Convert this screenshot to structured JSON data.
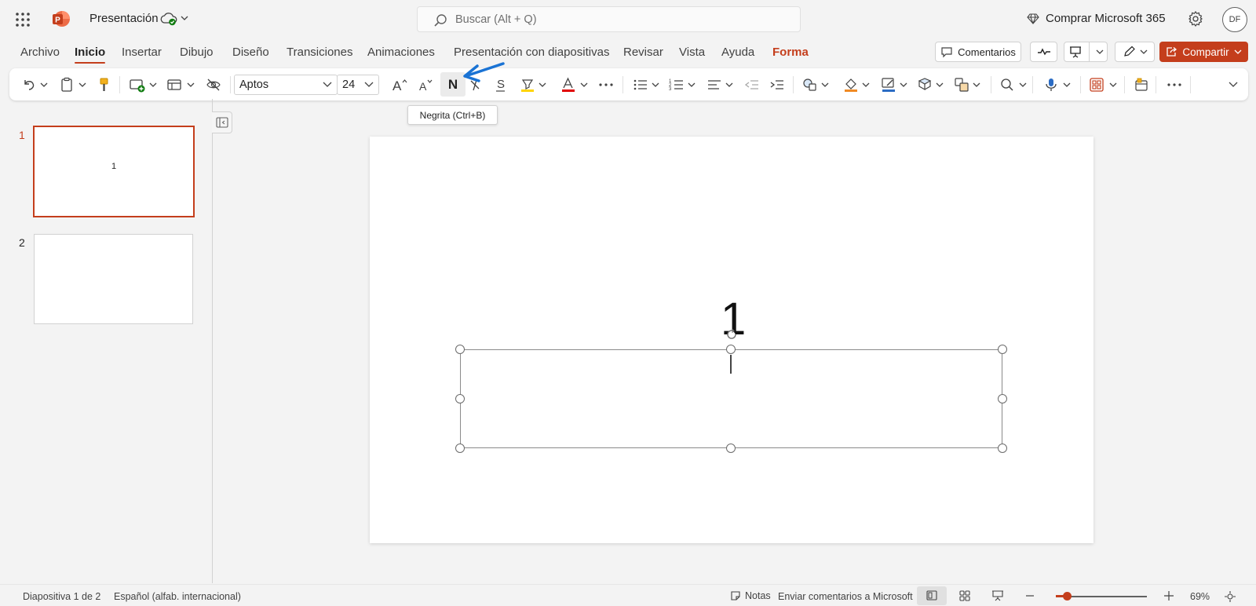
{
  "app": {
    "title": "Presentación",
    "search_placeholder": "Buscar (Alt + Q)",
    "buy_label": "Comprar Microsoft 365",
    "user_initials": "DF"
  },
  "tabs": [
    "Archivo",
    "Inicio",
    "Insertar",
    "Dibujo",
    "Diseño",
    "Transiciones",
    "Animaciones",
    "Presentación con diapositivas",
    "Revisar",
    "Vista",
    "Ayuda",
    "Forma"
  ],
  "active_tab": "Inicio",
  "actions": {
    "comments_label": "Comentarios",
    "share_label": "Compartir"
  },
  "ribbon": {
    "font_name": "Aptos",
    "font_size": "24",
    "bold_glyph": "N",
    "tooltip": "Negrita (Ctrl+B)"
  },
  "slides": [
    {
      "number": "1",
      "thumb_text": "1",
      "selected": true
    },
    {
      "number": "2",
      "thumb_text": "",
      "selected": false
    }
  ],
  "slide_canvas": {
    "text": "1"
  },
  "status": {
    "slide_counter": "Diapositiva 1 de 2",
    "language": "Español (alfab. internacional)",
    "notes_label": "Notas",
    "feedback_label": "Enviar comentarios a Microsoft",
    "zoom": "69%"
  },
  "colors": {
    "accent": "#c43e1c",
    "annotation_arrow": "#1a73d4"
  }
}
